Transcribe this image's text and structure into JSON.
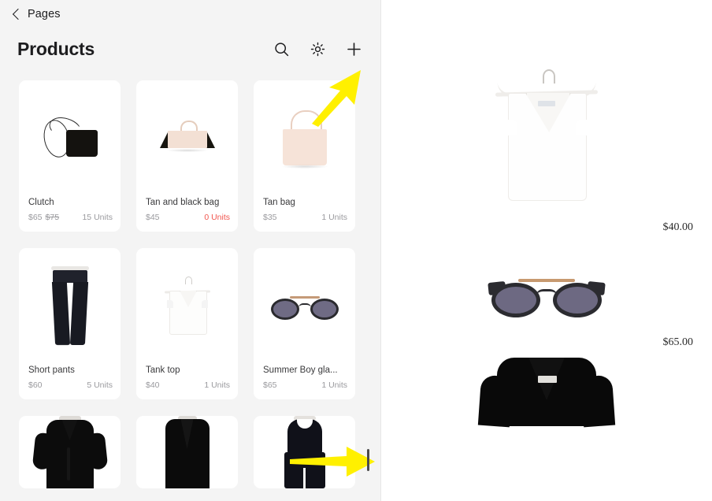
{
  "app": {
    "back_label": "Pages",
    "page_title": "Products",
    "back_icon": "chevron-left-icon"
  },
  "toolbar": {
    "search_icon": "search-icon",
    "settings_icon": "gear-icon",
    "add_icon": "plus-icon"
  },
  "products": [
    {
      "name": "Clutch",
      "price": "$65",
      "old_price": "$75",
      "units": "15 Units",
      "out_of_stock": false,
      "art": "clutch"
    },
    {
      "name": "Tan and black bag",
      "price": "$45",
      "old_price": "",
      "units": "0 Units",
      "out_of_stock": true,
      "art": "tan-black-bag"
    },
    {
      "name": "Tan bag",
      "price": "$35",
      "old_price": "",
      "units": "1 Units",
      "out_of_stock": false,
      "art": "tan-bag"
    },
    {
      "name": "Short pants",
      "price": "$60",
      "old_price": "",
      "units": "5 Units",
      "out_of_stock": false,
      "art": "short-pants"
    },
    {
      "name": "Tank top",
      "price": "$40",
      "old_price": "",
      "units": "1 Units",
      "out_of_stock": false,
      "art": "tank-top"
    },
    {
      "name": "Summer Boy gla...",
      "price": "$65",
      "old_price": "",
      "units": "1 Units",
      "out_of_stock": false,
      "art": "sunglasses"
    },
    {
      "name": "",
      "price": "",
      "old_price": "",
      "units": "",
      "out_of_stock": false,
      "art": "black-robe"
    },
    {
      "name": "",
      "price": "",
      "old_price": "",
      "units": "",
      "out_of_stock": false,
      "art": "black-coat"
    },
    {
      "name": "",
      "price": "",
      "old_price": "",
      "units": "",
      "out_of_stock": false,
      "art": "black-jumpsuit"
    }
  ],
  "preview": {
    "items": [
      {
        "art": "tank-top",
        "price": "$40.00"
      },
      {
        "art": "sunglasses",
        "price": "$65.00"
      },
      {
        "art": "black-robe",
        "price": ""
      }
    ]
  },
  "annotations": {
    "arrow_to_add_button": "yellow-arrow-up-right",
    "arrow_to_resize_handle": "yellow-arrow-right",
    "resize_handle": "panel-resize-handle"
  },
  "colors": {
    "left_panel_bg": "#f4f4f4",
    "card_bg": "#ffffff",
    "text_primary": "#1d1d1f",
    "text_secondary": "#9a9a9e",
    "out_of_stock": "#f1564f",
    "annotation": "#fff000"
  }
}
